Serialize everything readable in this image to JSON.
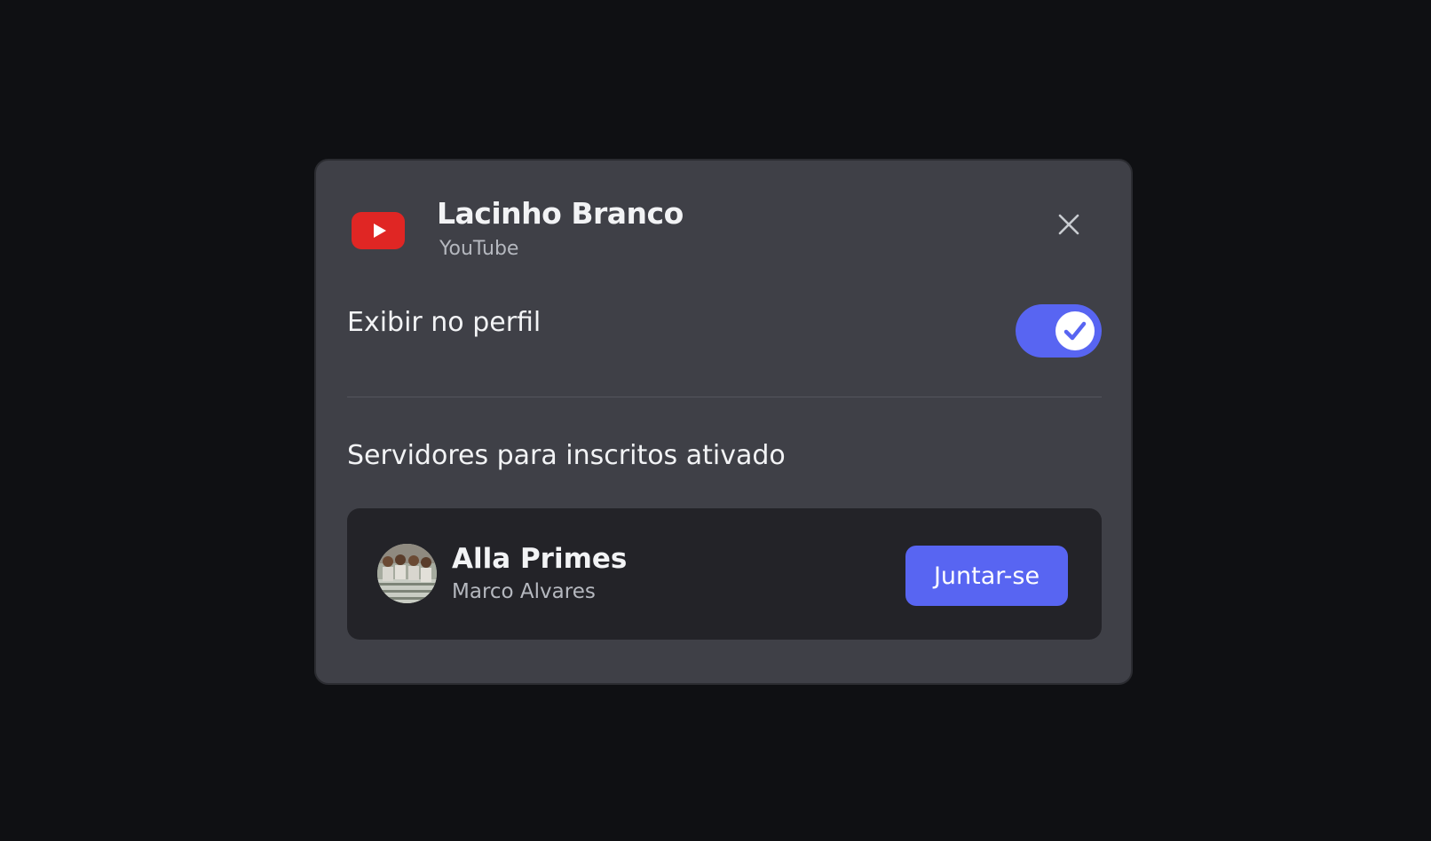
{
  "modal": {
    "title": "Lacinho Branco",
    "platform": "YouTube",
    "platform_icon": "youtube-icon",
    "close_icon": "close-icon"
  },
  "profile_toggle": {
    "label": "Exibir no perfil",
    "enabled": true,
    "icon": "checkmark-icon"
  },
  "subscriber_servers": {
    "heading": "Servidores para inscritos ativado",
    "servers": [
      {
        "name": "Alla Primes",
        "owner": "Marco Alvares",
        "join_label": "Juntar-se"
      }
    ]
  },
  "colors": {
    "background": "#0f1013",
    "modal": "#3f4047",
    "card": "#232328",
    "accent": "#5865f2",
    "youtube_red": "#e02624",
    "text_primary": "#f2f3f5",
    "text_secondary": "#b5b8bf"
  }
}
